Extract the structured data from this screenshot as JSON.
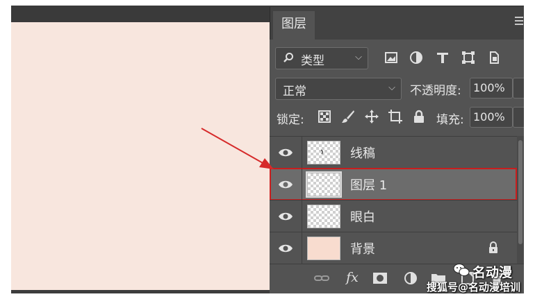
{
  "panel": {
    "tab_label": "图层",
    "filter": {
      "label": "类型"
    },
    "blend_mode": "正常",
    "opacity_label": "不透明度:",
    "opacity_value": "100%",
    "lock_label": "锁定:",
    "fill_label": "填充:",
    "fill_value": "100%"
  },
  "layers": [
    {
      "name": "线稿",
      "visible": true,
      "selected": false,
      "locked": false,
      "thumb": "transparent"
    },
    {
      "name": "图层 1",
      "visible": true,
      "selected": true,
      "locked": false,
      "thumb": "transparent"
    },
    {
      "name": "眼白",
      "visible": true,
      "selected": false,
      "locked": false,
      "thumb": "transparent"
    },
    {
      "name": "背景",
      "visible": true,
      "selected": false,
      "locked": true,
      "thumb": "solid"
    }
  ],
  "bottom_bar": {
    "fx_label": "fx"
  },
  "watermark": {
    "brand": "名动漫",
    "source": "搜狐号@名动漫培训"
  },
  "colors": {
    "canvas": "#f8e6de",
    "panel": "#535353",
    "selection_outline": "#c91e1e",
    "arrow": "#d62a2a"
  }
}
